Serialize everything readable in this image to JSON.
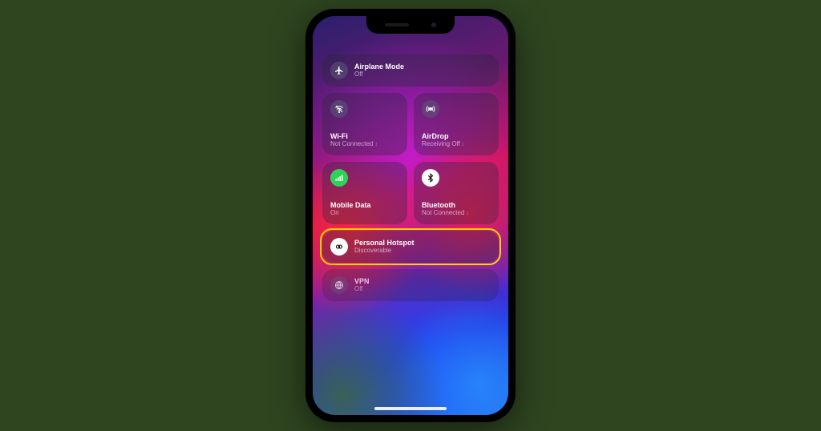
{
  "tiles": {
    "airplane": {
      "label": "Airplane Mode",
      "status": "Off"
    },
    "wifi": {
      "label": "Wi-Fi",
      "status": "Not Connected"
    },
    "airdrop": {
      "label": "AirDrop",
      "status": "Receiving Off"
    },
    "cellular": {
      "label": "Mobile Data",
      "status": "On"
    },
    "bluetooth": {
      "label": "Bluetooth",
      "status": "Not Connected"
    },
    "hotspot": {
      "label": "Personal Hotspot",
      "status": "Discoverable"
    },
    "vpn": {
      "label": "VPN",
      "status": "Off"
    }
  }
}
